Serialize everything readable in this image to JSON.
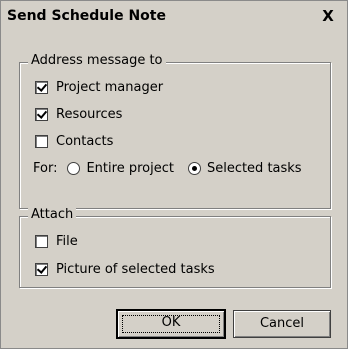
{
  "dialog": {
    "title": "Send Schedule Note",
    "close_label": "X"
  },
  "address_group": {
    "label": "Address message to",
    "options": [
      {
        "label": "Project manager",
        "checked": true
      },
      {
        "label": "Resources",
        "checked": true
      },
      {
        "label": "Contacts",
        "checked": false
      }
    ],
    "for_label": "For:",
    "radios": [
      {
        "label": "Entire project",
        "selected": false
      },
      {
        "label": "Selected tasks",
        "selected": true
      }
    ]
  },
  "attach_group": {
    "label": "Attach",
    "options": [
      {
        "label": "File",
        "checked": false
      },
      {
        "label": "Picture of selected tasks",
        "checked": true
      }
    ]
  },
  "buttons": {
    "ok": "OK",
    "cancel": "Cancel"
  }
}
